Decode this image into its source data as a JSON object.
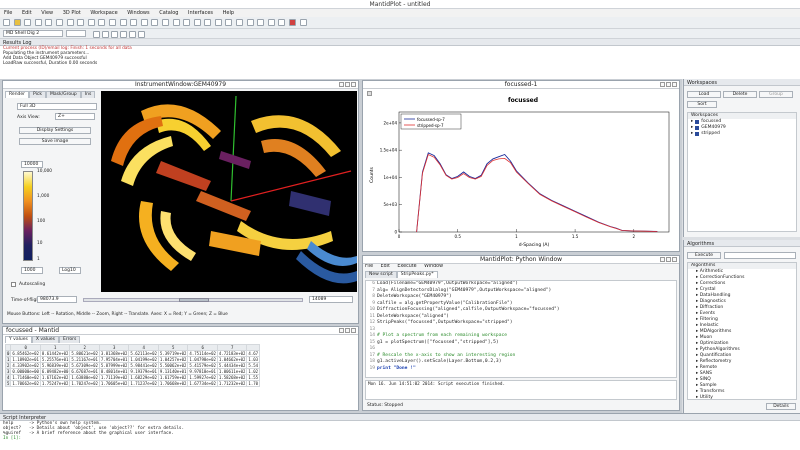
{
  "app": {
    "title": "MantidPlot - untitled"
  },
  "menu": [
    "File",
    "Edit",
    "View",
    "3D Plot",
    "Workspace",
    "Windows",
    "Catalog",
    "Interfaces",
    "Help"
  ],
  "toolbar2": {
    "combo_label": "MD Shell Dig 2",
    "combo2": ""
  },
  "results_log": {
    "title": "Results Log",
    "lines": [
      "Current process (ID)/email log: Finish: 1 seconds for all data",
      "Populating the instrument parameters...",
      "Add Data Object GEM40979 successful",
      "LoadRaw successful, Duration 0.00 seconds"
    ]
  },
  "instrument_window": {
    "title": "InstrumentWindow:GEM40979",
    "tabs": [
      "Render",
      "Pick",
      "Mask/Group",
      "Ins"
    ],
    "render_mode": "Full 3D",
    "axis_view_label": "Axis View:",
    "axis_view": "Z+",
    "display_settings": "Display Settings",
    "save_image": "Save image",
    "scale_top": "10000",
    "scale_max": "10,000",
    "scale_mid1": "1,000",
    "scale_mid2": "100",
    "scale_mid3": "10",
    "scale_min": "1",
    "scale_bottom": "1000",
    "scale_type": "Log10",
    "autoscaling": "Autoscaling",
    "tof_label": "Time-of-flight",
    "tof_min": "98073.9",
    "tof_max": "14089",
    "mouse_help": "Mouse Buttons: Left -- Rotation, Middle -- Zoom, Right -- Translate. Axes: X = Red; Y = Green; Z = Blue"
  },
  "plot_window": {
    "title": "focussed-1",
    "plot_title": "focussed",
    "legend": [
      "focussed-sp-7",
      "stripped-sp-7"
    ],
    "xlabel": "d-Spacing (A)",
    "ylabel": "Counts"
  },
  "chart_data": {
    "type": "line",
    "title": "focussed",
    "xlabel": "d-Spacing (A)",
    "ylabel": "Counts",
    "xlim": [
      0,
      2.3
    ],
    "ylim": [
      0,
      22000
    ],
    "x_ticks": [
      "0",
      "0.5",
      "1",
      "1.5",
      "2"
    ],
    "y_ticks": [
      "2e+04",
      "1.5e+04",
      "1e+04",
      "5e+03",
      "0"
    ],
    "series": [
      {
        "name": "focussed-sp-7",
        "color": "#1a2a9a",
        "x": [
          0.15,
          0.2,
          0.25,
          0.3,
          0.35,
          0.4,
          0.45,
          0.5,
          0.55,
          0.6,
          0.65,
          0.7,
          0.75,
          0.8,
          0.85,
          0.9,
          0.95,
          1.0,
          1.1,
          1.2,
          1.3,
          1.4,
          1.5,
          1.6,
          1.7,
          1.8,
          1.85,
          1.9,
          2.0,
          2.1,
          2.2
        ],
        "y": [
          0,
          11000,
          14500,
          14000,
          12500,
          10500,
          9800,
          10200,
          11000,
          10200,
          9800,
          10400,
          12500,
          13400,
          13800,
          14200,
          13000,
          11200,
          9000,
          7000,
          5800,
          4800,
          3800,
          2800,
          1800,
          1000,
          700,
          300,
          200,
          150,
          100
        ]
      },
      {
        "name": "stripped-sp-7",
        "color": "#e03030",
        "x": [
          0.15,
          0.2,
          0.25,
          0.3,
          0.35,
          0.4,
          0.45,
          0.5,
          0.55,
          0.6,
          0.65,
          0.7,
          0.75,
          0.8,
          0.85,
          0.9,
          0.95,
          1.0,
          1.1,
          1.2,
          1.3,
          1.4,
          1.5,
          1.6,
          1.7,
          1.8,
          1.85,
          1.9,
          2.0,
          2.1,
          2.2
        ],
        "y": [
          0,
          10800,
          14200,
          13700,
          12300,
          10400,
          9700,
          10000,
          10700,
          10000,
          9700,
          10200,
          12200,
          13100,
          13400,
          13500,
          12700,
          11000,
          8900,
          6900,
          5700,
          4700,
          3700,
          2700,
          1750,
          950,
          650,
          280,
          180,
          140,
          90
        ]
      }
    ]
  },
  "table_window": {
    "title": "focussed - Mantid",
    "tabs": [
      "Y values",
      "X values",
      "Errors"
    ],
    "headers": [
      "",
      "0",
      "1",
      "2",
      "3",
      "4",
      "5",
      "6",
      "7",
      ""
    ],
    "rows": [
      [
        "0",
        "6.85462e+02",
        "8.61442e+02",
        "5.80621e+02",
        "3.81368e+02",
        "5.62113e+02",
        "5.39719e+02",
        "4.75114e+02",
        "4.72183e+02",
        "4.67"
      ],
      [
        "1",
        "1.18902e+01",
        "5.25576e+01",
        "5.21167e+01",
        "7.95704e+01",
        "1.04199e+02",
        "1.04257e+02",
        "1.04798e+02",
        "1.04662e+02",
        "1.03"
      ],
      [
        "2",
        "4.33902e+02",
        "5.96839e+02",
        "5.67309e+02",
        "5.87999e+02",
        "5.98441e+02",
        "5.50062e+02",
        "5.41579e+02",
        "5.44434e+02",
        "5.54"
      ],
      [
        "3",
        "0.00000e+00",
        "6.09482e+00",
        "6.67687e+01",
        "8.48014e+01",
        "9.19379e+01",
        "9.13140e+01",
        "9.97818e+01",
        "1.00611e+02",
        "1.02"
      ],
      [
        "4",
        "1.71460e+02",
        "1.67162e+02",
        "1.63880e+02",
        "1.71139e+02",
        "1.68229e+02",
        "1.61759e+02",
        "1.59927e+02",
        "1.58268e+02",
        "1.55"
      ],
      [
        "5",
        "1.70662e+02",
        "1.75247e+02",
        "1.70247e+02",
        "1.70605e+02",
        "1.71237e+02",
        "1.70668e+02",
        "1.67734e+02",
        "1.71232e+02",
        "1.70"
      ]
    ]
  },
  "python_window": {
    "title": "MantidPlot: Python Window",
    "menu": [
      "File",
      "Edit",
      "Execute",
      "Window"
    ],
    "tabs": [
      "New script",
      "StripPeaks.py*"
    ],
    "lines": [
      {
        "n": "6",
        "t": "Load(Filename=\"GEM40979\",OutputWorkspace=\"aligned\")",
        "cls": ""
      },
      {
        "n": "7",
        "t": "alg= AlignDetectorsDialog(\"GEM40979\",OutputWorkspace=\"aligned\")",
        "cls": ""
      },
      {
        "n": "8",
        "t": "DeleteWorkspace(\"GEM40979\")",
        "cls": ""
      },
      {
        "n": "9",
        "t": "calfile = alg.getPropertyValue(\"CalibrationFile\")",
        "cls": ""
      },
      {
        "n": "10",
        "t": "DiffractionFocussing(\"aligned\",calfile,OutputWorkspace=\"focussed\")",
        "cls": ""
      },
      {
        "n": "11",
        "t": "DeleteWorkspace(\"aligned\")",
        "cls": ""
      },
      {
        "n": "12",
        "t": "StripPeaks(\"focussed\",OutputWorkspace=\"stripped\")",
        "cls": ""
      },
      {
        "n": "13",
        "t": "",
        "cls": ""
      },
      {
        "n": "14",
        "t": "# Plot a spectrum from each remaining workspace",
        "cls": "cmt"
      },
      {
        "n": "15",
        "t": "g1 = plotSpectrum([\"focussed\",\"stripped\"],5)",
        "cls": ""
      },
      {
        "n": "16",
        "t": "",
        "cls": ""
      },
      {
        "n": "17",
        "t": "# Rescale the x-axis to show an interesting region",
        "cls": "cmt"
      },
      {
        "n": "18",
        "t": "g1.activeLayer().setScale(Layer.Bottom,0.2,3)",
        "cls": ""
      },
      {
        "n": "19",
        "t": "print \"Done !\"",
        "cls": "kw"
      }
    ],
    "output": "Mon 16. Jun 14:51:02 2014: Script execution finished.",
    "status": "Status: Stopped"
  },
  "workspaces": {
    "title": "Workspaces",
    "load": "Load",
    "delete": "Delete",
    "group": "Group",
    "sort": "Sort",
    "tree_label": "Workspaces",
    "items": [
      "focussed",
      "GEM40979",
      "stripped"
    ]
  },
  "algorithms": {
    "title": "Algorithms",
    "execute": "Execute",
    "search_placeholder": "",
    "tree_label": "Algorithms",
    "items": [
      "Arithmetic",
      "CorrectionFunctions",
      "Corrections",
      "Crystal",
      "DataHandling",
      "Diagnostics",
      "Diffraction",
      "Events",
      "Filtering",
      "Inelastic",
      "MDAlgorithms",
      "Muon",
      "Optimization",
      "PythonAlgorithms",
      "Quantification",
      "Reflectometry",
      "Remote",
      "SANS",
      "SINQ",
      "Sample",
      "Transforms",
      "Utility"
    ],
    "details": "Details"
  },
  "interpreter": {
    "title": "Script Interpreter",
    "lines": [
      "help      -> Python's own help system.",
      "object?   -> Details about 'object', use 'object??' for extra details.",
      "%guiref   -> A brief reference about the graphical user interface.",
      "",
      "In [1]:"
    ]
  }
}
